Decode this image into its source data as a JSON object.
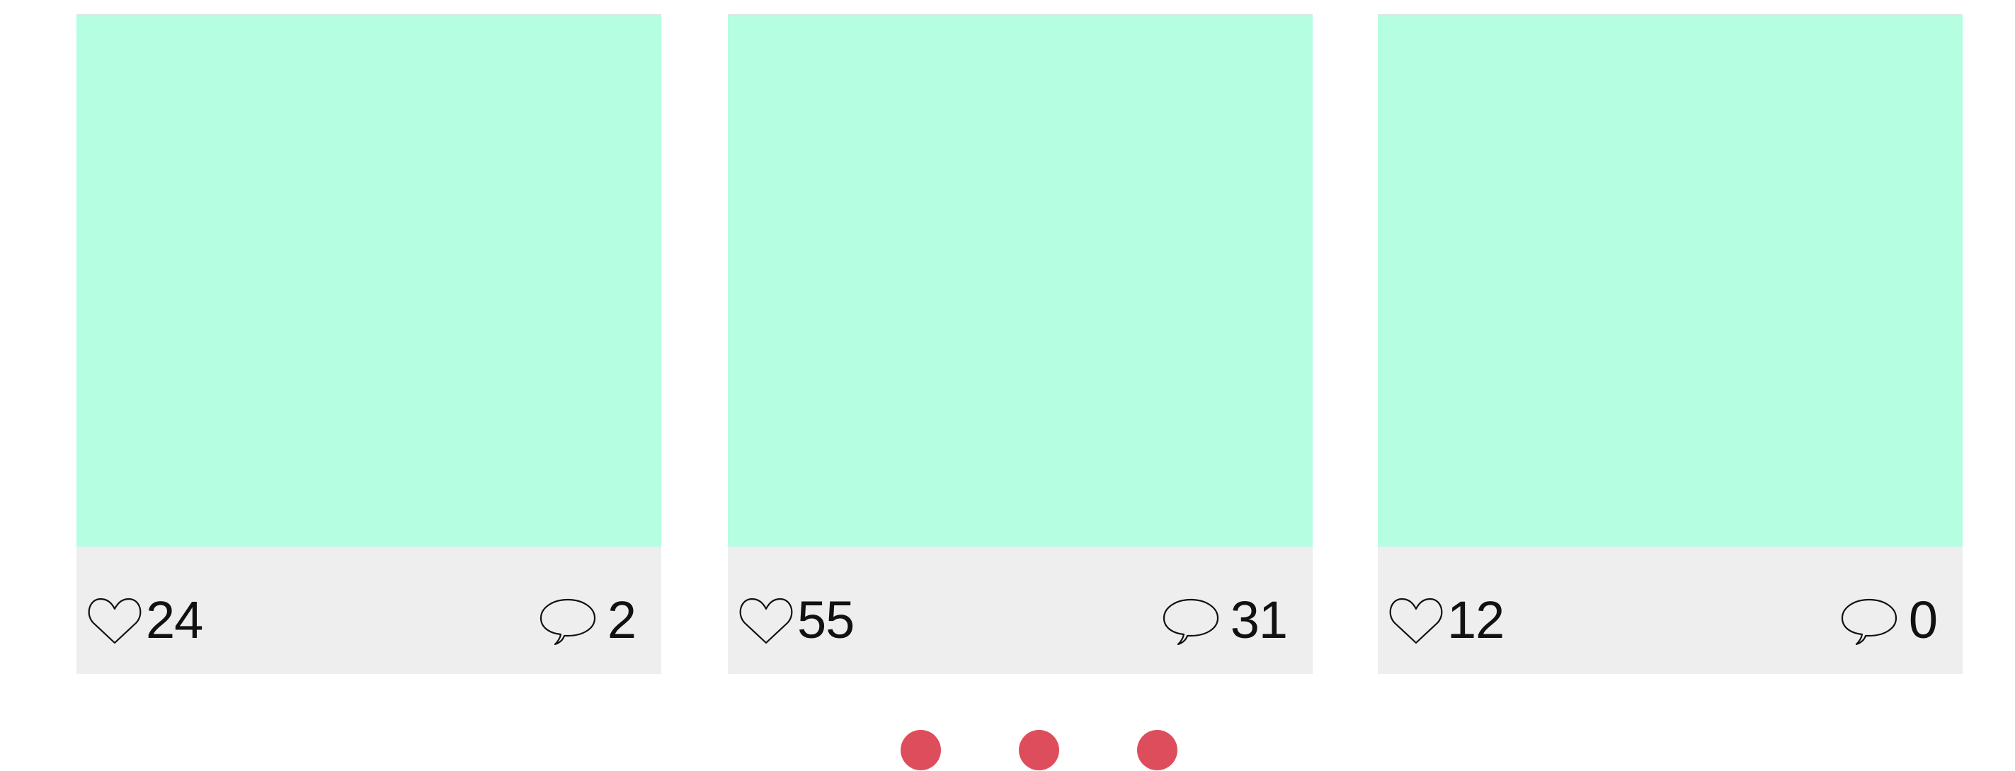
{
  "cards": [
    {
      "likes": "24",
      "comments": "2"
    },
    {
      "likes": "55",
      "comments": "31"
    },
    {
      "likes": "12",
      "comments": "0"
    }
  ],
  "pagination": {
    "dots": 3,
    "color": "#de4d5b"
  },
  "colors": {
    "image_placeholder": "#b5fee1",
    "footer_background": "#eeeeee"
  },
  "icons": {
    "like": "heart-icon",
    "comment": "speech-bubble-icon"
  }
}
